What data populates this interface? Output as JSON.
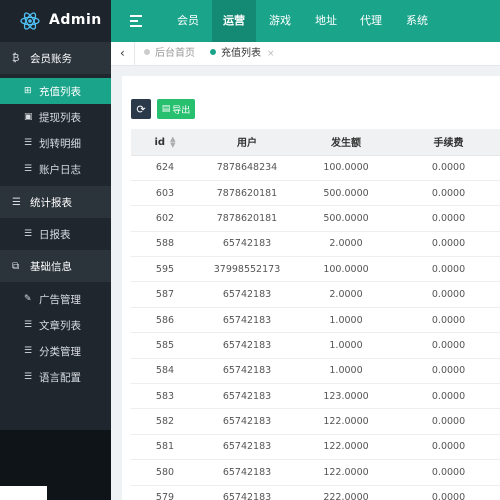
{
  "app": {
    "name": "Admin"
  },
  "topnav": {
    "items": [
      {
        "label": "会员",
        "active": false
      },
      {
        "label": "运营",
        "active": true
      },
      {
        "label": "游戏",
        "active": false
      },
      {
        "label": "地址",
        "active": false
      },
      {
        "label": "代理",
        "active": false
      },
      {
        "label": "系统",
        "active": false
      }
    ]
  },
  "sidebar": {
    "group_account": "会员账务",
    "account_items": [
      "充值列表",
      "提现列表",
      "划转明细",
      "账户日志"
    ],
    "group_stats": "统计报表",
    "stats_items": [
      "日报表"
    ],
    "group_basic": "基础信息",
    "basic_items": [
      "广告管理",
      "文章列表",
      "分类管理",
      "语言配置"
    ]
  },
  "tabs": {
    "home": "后台首页",
    "current": "充值列表",
    "close": "×"
  },
  "toolbar": {
    "export_label": "导出"
  },
  "table": {
    "headers": {
      "id": "id",
      "user": "用户",
      "amount": "发生额",
      "fee": "手续费"
    },
    "rows": [
      {
        "id": "624",
        "user": "7878648234",
        "amount": "100.0000",
        "fee": "0.0000"
      },
      {
        "id": "603",
        "user": "7878620181",
        "amount": "500.0000",
        "fee": "0.0000"
      },
      {
        "id": "602",
        "user": "7878620181",
        "amount": "500.0000",
        "fee": "0.0000"
      },
      {
        "id": "588",
        "user": "65742183",
        "amount": "2.0000",
        "fee": "0.0000"
      },
      {
        "id": "595",
        "user": "37998552173",
        "amount": "100.0000",
        "fee": "0.0000"
      },
      {
        "id": "587",
        "user": "65742183",
        "amount": "2.0000",
        "fee": "0.0000"
      },
      {
        "id": "586",
        "user": "65742183",
        "amount": "1.0000",
        "fee": "0.0000"
      },
      {
        "id": "585",
        "user": "65742183",
        "amount": "1.0000",
        "fee": "0.0000"
      },
      {
        "id": "584",
        "user": "65742183",
        "amount": "1.0000",
        "fee": "0.0000"
      },
      {
        "id": "583",
        "user": "65742183",
        "amount": "123.0000",
        "fee": "0.0000"
      },
      {
        "id": "582",
        "user": "65742183",
        "amount": "122.0000",
        "fee": "0.0000"
      },
      {
        "id": "581",
        "user": "65742183",
        "amount": "122.0000",
        "fee": "0.0000"
      },
      {
        "id": "580",
        "user": "65742183",
        "amount": "122.0000",
        "fee": "0.0000"
      },
      {
        "id": "579",
        "user": "65742183",
        "amount": "222.0000",
        "fee": "0.0000"
      }
    ]
  },
  "colors": {
    "accent": "#1aa58b",
    "accent_dark": "#148a74",
    "sidebar_bg": "#1f262d",
    "export_green": "#27c06f"
  },
  "icons": [
    "logo-atom-icon",
    "menu-toggle-icon",
    "bitcoin-icon",
    "plus-square-icon",
    "image-icon",
    "list-icon",
    "copy-icon",
    "chart-icon",
    "sort-icon",
    "refresh-icon",
    "export-file-icon",
    "back-chevron-icon"
  ]
}
